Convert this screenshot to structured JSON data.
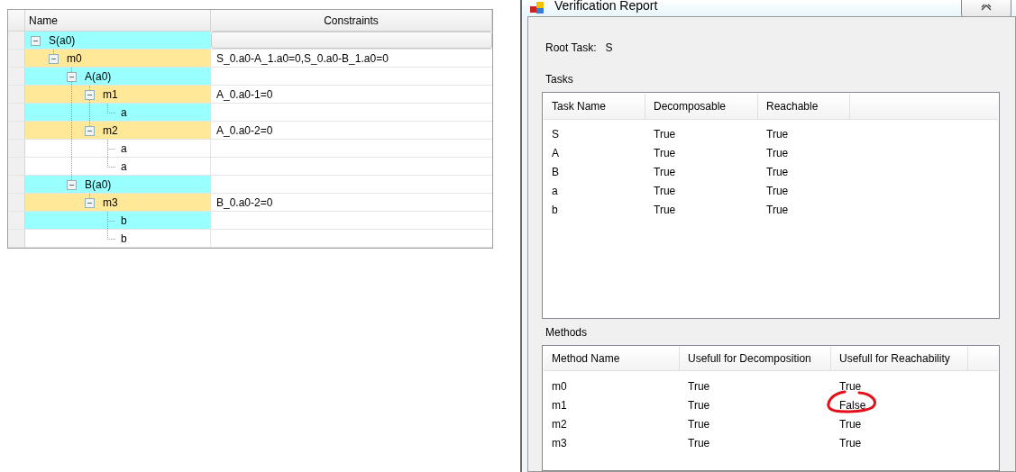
{
  "tree_grid": {
    "columns": [
      "Name",
      "Constraints"
    ],
    "nodes": [
      {
        "name": "S(a0)",
        "color": "#99ffff",
        "expanded": true,
        "selected": true,
        "children": [
          {
            "name": "m0",
            "constraints": "S_0.a0-A_1.a0=0,S_0.a0-B_1.a0=0",
            "color": "#ffe999",
            "expanded": true,
            "selected": false,
            "children": [
              {
                "name": "A(a0)",
                "color": "#99ffff",
                "expanded": true,
                "selected": false,
                "children": [
                  {
                    "name": "m1",
                    "constraints": "A_0.a0-1=0",
                    "color": "#ffe999",
                    "expanded": true,
                    "selected": false,
                    "children": [
                      {
                        "name": "a",
                        "color": "#99ffff",
                        "selected": false
                      }
                    ]
                  },
                  {
                    "name": "m2",
                    "constraints": "A_0.a0-2=0",
                    "color": "#ffe999",
                    "expanded": true,
                    "selected": false,
                    "children": [
                      {
                        "name": "a",
                        "color": "#ffffff",
                        "selected": false
                      },
                      {
                        "name": "a",
                        "color": "#ffffff",
                        "selected": false
                      }
                    ]
                  }
                ]
              },
              {
                "name": "B(a0)",
                "color": "#99ffff",
                "expanded": true,
                "selected": false,
                "children": [
                  {
                    "name": "m3",
                    "constraints": "B_0.a0-2=0",
                    "color": "#ffe999",
                    "expanded": true,
                    "selected": false,
                    "children": [
                      {
                        "name": "b",
                        "color": "#99ffff",
                        "selected": false
                      },
                      {
                        "name": "b",
                        "color": "#ffffff",
                        "selected": false
                      }
                    ]
                  }
                ]
              }
            ]
          }
        ]
      }
    ]
  },
  "window": {
    "title": "Verification Report"
  },
  "root_task": {
    "label": "Root Task:",
    "value": "S"
  },
  "tasks": {
    "label": "Tasks",
    "columns": [
      "Task Name",
      "Decomposable",
      "Reachable"
    ],
    "rows": [
      [
        "S",
        "True",
        "True"
      ],
      [
        "A",
        "True",
        "True"
      ],
      [
        "B",
        "True",
        "True"
      ],
      [
        "a",
        "True",
        "True"
      ],
      [
        "b",
        "True",
        "True"
      ]
    ]
  },
  "methods": {
    "label": "Methods",
    "columns": [
      "Method Name",
      "Usefull for Decomposition",
      "Usefull for Reachability"
    ],
    "rows": [
      {
        "cells": [
          "m0",
          "True",
          "True"
        ],
        "circled": false
      },
      {
        "cells": [
          "m1",
          "True",
          "False"
        ],
        "circled": true
      },
      {
        "cells": [
          "m2",
          "True",
          "True"
        ],
        "circled": false
      },
      {
        "cells": [
          "m3",
          "True",
          "True"
        ],
        "circled": false
      }
    ]
  }
}
